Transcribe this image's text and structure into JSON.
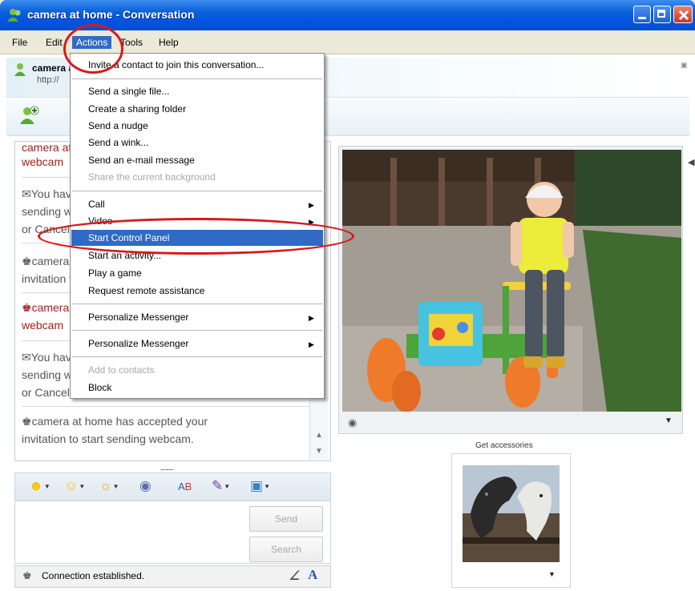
{
  "window": {
    "title": "camera at home - Conversation"
  },
  "menubar": {
    "items": [
      "File",
      "Edit",
      "Actions",
      "Tools",
      "Help"
    ],
    "selected": "Actions"
  },
  "contact": {
    "name": "camera at home",
    "url": "http://"
  },
  "actions_menu": {
    "items": [
      {
        "label": "Invite a contact to join this conversation...",
        "enabled": true
      },
      {
        "label": "Send a single file...",
        "enabled": true
      },
      {
        "label": "Create a sharing folder",
        "enabled": true
      },
      {
        "label": "Send a nudge",
        "enabled": true
      },
      {
        "label": "Send a wink...",
        "enabled": true
      },
      {
        "label": "Send an e-mail message",
        "enabled": true
      },
      {
        "label": "Share the current background",
        "enabled": false
      },
      {
        "label": "Call",
        "enabled": true,
        "submenu": true
      },
      {
        "label": "Video",
        "enabled": true,
        "submenu": true
      },
      {
        "label": "Start Control Panel",
        "enabled": true,
        "highlighted": true
      },
      {
        "label": "Start an activity...",
        "enabled": true
      },
      {
        "label": "Play a game",
        "enabled": true
      },
      {
        "label": "Request remote assistance",
        "enabled": true
      },
      {
        "label": "Personalize Messenger",
        "enabled": true,
        "submenu": true
      },
      {
        "label": "Personalize Messenger",
        "enabled": true,
        "submenu": true
      },
      {
        "label": "Add to contacts",
        "enabled": false
      },
      {
        "label": "Block",
        "enabled": true
      }
    ]
  },
  "history": {
    "lines": [
      {
        "text": "camera at home",
        "style": "red"
      },
      {
        "text": "webcam",
        "style": "red"
      },
      {
        "text": "You have invited camera at home to start",
        "style": "dark"
      },
      {
        "text": "sending webcam. Please wait for a response",
        "style": "dark"
      },
      {
        "text": "or Cancel (Alt+Q) the pending invitation.",
        "style": "dark"
      },
      {
        "text": "camera at home has accepted your",
        "style": "dark"
      },
      {
        "text": "invitation to start sending webcam.",
        "style": "dark"
      },
      {
        "text": "camera at home would like to send you",
        "style": "red"
      },
      {
        "text": "webcam",
        "style": "red"
      },
      {
        "text": "You have invited camera at home to start",
        "style": "dark"
      },
      {
        "text": "sending webcam. Please wait for a response",
        "style": "dark"
      },
      {
        "text": "or Cancel (Alt+Q) the pending invitation.",
        "style": "dark"
      },
      {
        "text": "camera at home has accepted your",
        "style": "dark"
      },
      {
        "text": "invitation to start sending webcam.",
        "style": "dark"
      }
    ]
  },
  "compose": {
    "send_label": "Send",
    "search_label": "Search",
    "grip": "........."
  },
  "status": {
    "text": "Connection established."
  },
  "side": {
    "accessories_label": "Get accessories"
  },
  "colors": {
    "title_blue": "#0054e3",
    "menu_highlight": "#316ac5",
    "annotation_red": "#d7191c",
    "history_red": "#a3201a"
  },
  "icons": [
    "messenger-icon",
    "minimize-icon",
    "maximize-icon",
    "close-icon",
    "buddy-icon",
    "invite-icon",
    "emoticon-icon",
    "wink-icon",
    "nudge-icon",
    "font-icon",
    "text-style-icon",
    "webcam-icon",
    "dropdown-arrow-icon",
    "submenu-arrow-icon"
  ]
}
